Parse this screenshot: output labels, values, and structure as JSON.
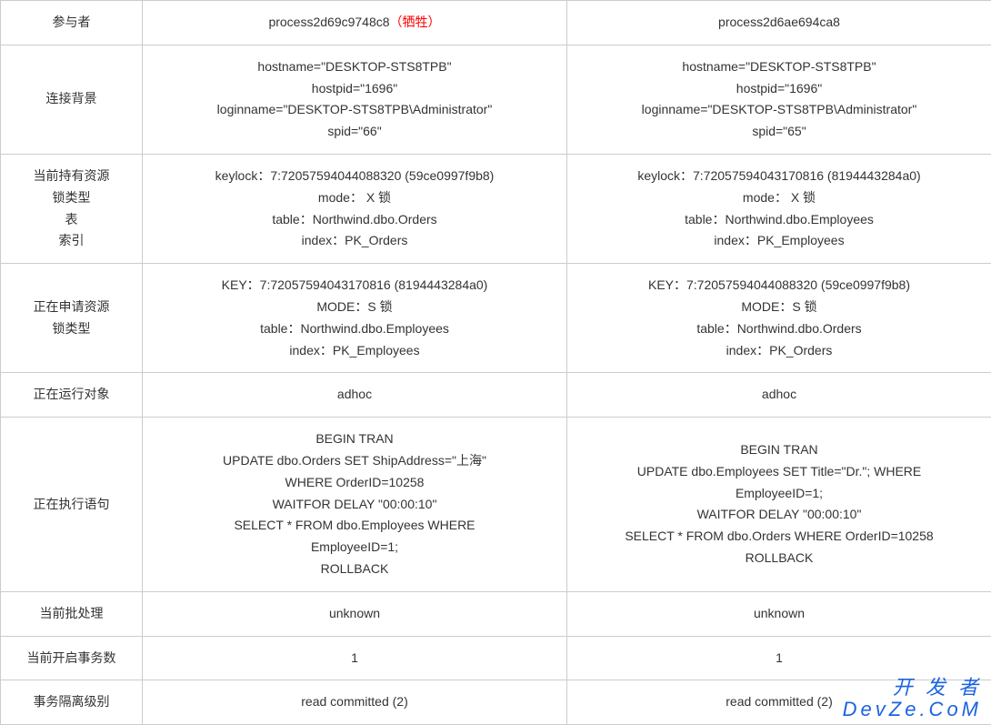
{
  "rows": {
    "labels": {
      "participant": "参与者",
      "connection": "连接背景",
      "holding": "当前持有资源\n锁类型\n表\n索引",
      "requesting": "正在申请资源\n锁类型",
      "running_object": "正在运行对象",
      "executing_stmt": "正在执行语句",
      "batch": "当前批处理",
      "tran_count": "当前开启事务数",
      "isolation": "事务隔离级别"
    },
    "col1": {
      "participant_main": "process2d69c9748c8",
      "participant_suffix": "（牺牲）",
      "connection": "hostname=\"DESKTOP-STS8TPB\"\nhostpid=\"1696\"\nloginname=\"DESKTOP-STS8TPB\\Administrator\"\nspid=\"66\"",
      "holding": "keylock：7:72057594044088320 (59ce0997f9b8)\nmode：   X 锁\ntable：Northwind.dbo.Orders\nindex：PK_Orders",
      "requesting": "KEY：7:72057594043170816 (8194443284a0)\nMODE：S 锁\ntable：Northwind.dbo.Employees\nindex：PK_Employees",
      "running_object": "adhoc",
      "executing_stmt": "BEGIN TRAN\nUPDATE  dbo.Orders SET  ShipAddress=\"上海\"\nWHERE OrderID=10258\nWAITFOR DELAY \"00:00:10\"\nSELECT * FROM dbo.Employees WHERE\nEmployeeID=1;\nROLLBACK",
      "batch": "unknown",
      "tran_count": "1",
      "isolation": "read committed (2)"
    },
    "col2": {
      "participant_main": "process2d6ae694ca8",
      "connection": "hostname=\"DESKTOP-STS8TPB\"\nhostpid=\"1696\"\nloginname=\"DESKTOP-STS8TPB\\Administrator\"\nspid=\"65\"",
      "holding": "keylock：7:72057594043170816 (8194443284a0)\nmode：   X 锁\ntable：Northwind.dbo.Employees\nindex：PK_Employees",
      "requesting": "KEY：7:72057594044088320 (59ce0997f9b8)\nMODE：S 锁\ntable：Northwind.dbo.Orders\nindex：PK_Orders",
      "running_object": "adhoc",
      "executing_stmt": "BEGIN TRAN\nUPDATE dbo.Employees SET Title=\"Dr.\"; WHERE\nEmployeeID=1;\nWAITFOR DELAY \"00:00:10\"\nSELECT * FROM dbo.Orders WHERE OrderID=10258\nROLLBACK",
      "batch": "unknown",
      "tran_count": "1",
      "isolation": "read committed (2)"
    }
  },
  "watermark": {
    "top": "开 发 者",
    "bottom": "DevZe.CoM"
  }
}
